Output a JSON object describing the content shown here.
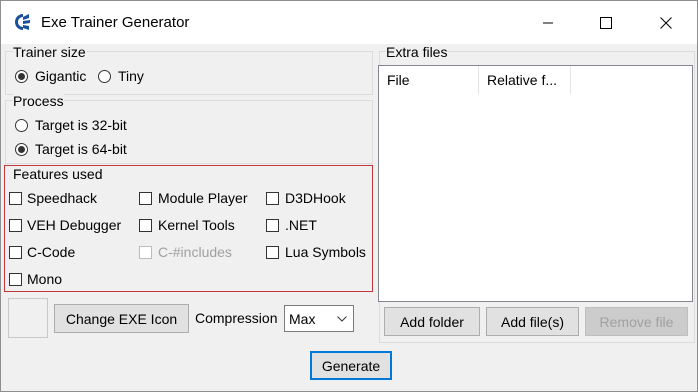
{
  "window": {
    "title": "Exe Trainer Generator",
    "minimize_icon": "minimize-icon",
    "maximize_icon": "maximize-icon",
    "close_icon": "close-icon"
  },
  "trainer_size": {
    "label": "Trainer size",
    "options": [
      {
        "label": "Gigantic",
        "checked": true
      },
      {
        "label": "Tiny",
        "checked": false
      }
    ]
  },
  "process": {
    "label": "Process",
    "options": [
      {
        "label": "Target is 32-bit",
        "checked": false
      },
      {
        "label": "Target is 64-bit",
        "checked": true
      }
    ]
  },
  "features": {
    "label": "Features used",
    "border_color": "#c0393b",
    "items": [
      {
        "label": "Speedhack",
        "checked": false,
        "enabled": true
      },
      {
        "label": "Module Player",
        "checked": false,
        "enabled": true
      },
      {
        "label": "D3DHook",
        "checked": false,
        "enabled": true
      },
      {
        "label": "VEH Debugger",
        "checked": false,
        "enabled": true
      },
      {
        "label": "Kernel Tools",
        "checked": false,
        "enabled": true
      },
      {
        "label": ".NET",
        "checked": false,
        "enabled": true
      },
      {
        "label": "C-Code",
        "checked": false,
        "enabled": true
      },
      {
        "label": "C-#includes",
        "checked": false,
        "enabled": false
      },
      {
        "label": "Lua Symbols",
        "checked": false,
        "enabled": true
      },
      {
        "label": "Mono",
        "checked": false,
        "enabled": true
      }
    ]
  },
  "icon_area": {
    "change_icon_label": "Change EXE Icon"
  },
  "compression": {
    "label": "Compression",
    "value": "Max"
  },
  "extra_files": {
    "label": "Extra files",
    "columns": [
      "File",
      "Relative f..."
    ],
    "add_folder_label": "Add folder",
    "add_files_label": "Add file(s)",
    "remove_file_label": "Remove file"
  },
  "generate_label": "Generate",
  "accent_color": "#0078d7"
}
